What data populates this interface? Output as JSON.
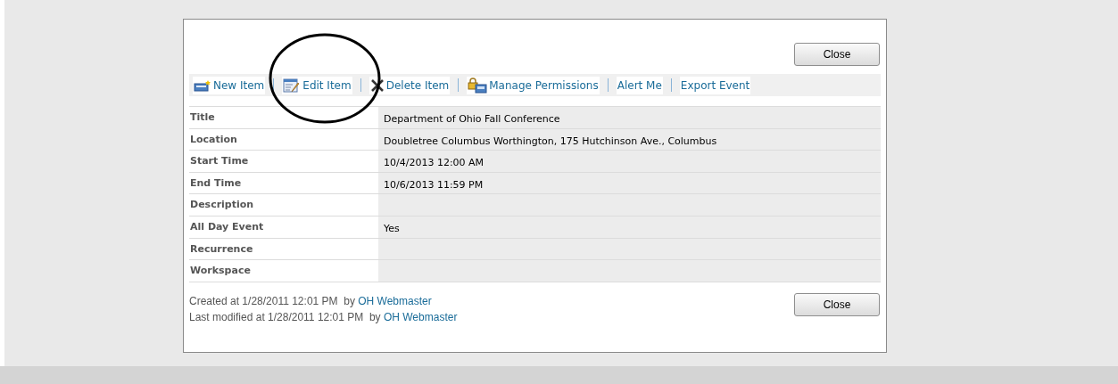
{
  "top_close": "Close",
  "toolbar": [
    {
      "label": "New Item",
      "kind": "new"
    },
    {
      "label": "Edit Item",
      "kind": "edit"
    },
    {
      "label": "Delete Item",
      "kind": "delete"
    },
    {
      "label": "Manage Permissions",
      "kind": "permissions"
    },
    {
      "label": "Alert Me",
      "kind": "plain"
    },
    {
      "label": "Export Event",
      "kind": "plain"
    }
  ],
  "fields": [
    {
      "label": "Title",
      "value": "Department of Ohio Fall Conference"
    },
    {
      "label": "Location",
      "value": "Doubletree Columbus Worthington, 175 Hutchinson Ave., Columbus"
    },
    {
      "label": "Start Time",
      "value": "10/4/2013 12:00 AM"
    },
    {
      "label": "End Time",
      "value": "10/6/2013 11:59 PM"
    },
    {
      "label": "Description"
    },
    {
      "label": "All Day Event",
      "value": "Yes"
    },
    {
      "label": "Recurrence"
    },
    {
      "label": "Workspace"
    }
  ],
  "footer": [
    {
      "text": "Created at 1/28/2011 12:01 PM  by ",
      "link": "OH Webmaster"
    },
    {
      "text": "Last modified at 1/28/2011 12:01 PM  by ",
      "link": "OH Webmaster"
    }
  ],
  "bottom_close": "Close",
  "annotation": {
    "kind": "ellipse"
  }
}
